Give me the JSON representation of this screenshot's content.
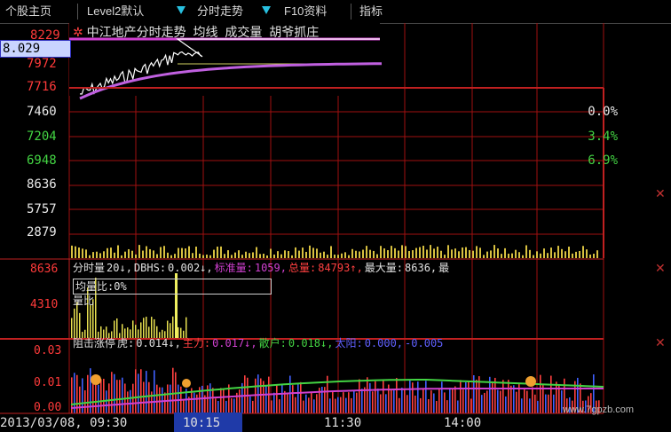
{
  "tabs": {
    "home": "个股主页",
    "level2": "Level2默认",
    "timeline": "分时走势",
    "f10": "F10资料",
    "indicator": "指标"
  },
  "chart": {
    "stock_title": "中江地产分时走势",
    "legend_line": "均线",
    "legend_volume": "成交量",
    "legend_tag": "胡爷抓庄"
  },
  "price_box": "8.029",
  "price_axis": [
    {
      "label": "8229",
      "color": "red"
    },
    {
      "label": "7972",
      "color": "red"
    },
    {
      "label": "7716",
      "color": "red"
    },
    {
      "label": "7460",
      "color": "white"
    },
    {
      "label": "7204",
      "color": "green"
    },
    {
      "label": "6948",
      "color": "green"
    }
  ],
  "volume_axis": [
    "8636",
    "5757",
    "2879"
  ],
  "pct_axis": [
    {
      "label": "0.0%",
      "color": "white"
    },
    {
      "label": "3.4%",
      "color": "green"
    },
    {
      "label": "6.9%",
      "color": "green"
    }
  ],
  "panel2": {
    "axis": [
      "8636",
      "4310"
    ],
    "legend": [
      {
        "text": "分时量",
        "color": "#e0e0e0"
      },
      {
        "text": "20↓,",
        "color": "#e0e0e0"
      },
      {
        "text": "DBHS:",
        "color": "#e0e0e0"
      },
      {
        "text": "0.002↓,",
        "color": "#e0e0e0"
      },
      {
        "text": "标准量:",
        "color": "#d040d0"
      },
      {
        "text": "1059,",
        "color": "#d040d0"
      },
      {
        "text": "总量:",
        "color": "#ff4040"
      },
      {
        "text": "84793↑,",
        "color": "#ff4040"
      },
      {
        "text": "最大量:",
        "color": "#e0e0e0"
      },
      {
        "text": "8636,",
        "color": "#e0e0e0"
      },
      {
        "text": "最",
        "color": "#e0e0e0"
      }
    ],
    "overlay_a": "均量比:0%",
    "overlay_b": "量比"
  },
  "panel3": {
    "axis": [
      "0.03",
      "0.01",
      "0.00"
    ],
    "legend": [
      {
        "text": "阻击涨停",
        "color": "#e0e0e0"
      },
      {
        "text": "虎:",
        "color": "#e0e0e0"
      },
      {
        "text": "0.014↓,",
        "color": "#e0e0e0"
      },
      {
        "text": "主力:",
        "color": "#ff4040"
      },
      {
        "text": "0.017↓,",
        "color": "#d040d0"
      },
      {
        "text": "散户:",
        "color": "#43d443"
      },
      {
        "text": "0.018↓,",
        "color": "#43d443"
      },
      {
        "text": "太阳:",
        "color": "#6060ff"
      },
      {
        "text": "0.000,",
        "color": "#6060ff"
      },
      {
        "text": "-0.005",
        "color": "#6060ff"
      }
    ]
  },
  "time_axis": [
    "2013/03/08, 09:30",
    "10:15",
    "11:30",
    "14:00"
  ],
  "watermark": "www.7gpzb.com",
  "colors": {
    "grid": "#a01010",
    "panel_border": "#c02020",
    "up": "#ff3a3a",
    "down": "#43d443",
    "avg_line": "#c060e0",
    "tab_arrow": "#28c0e0"
  }
}
